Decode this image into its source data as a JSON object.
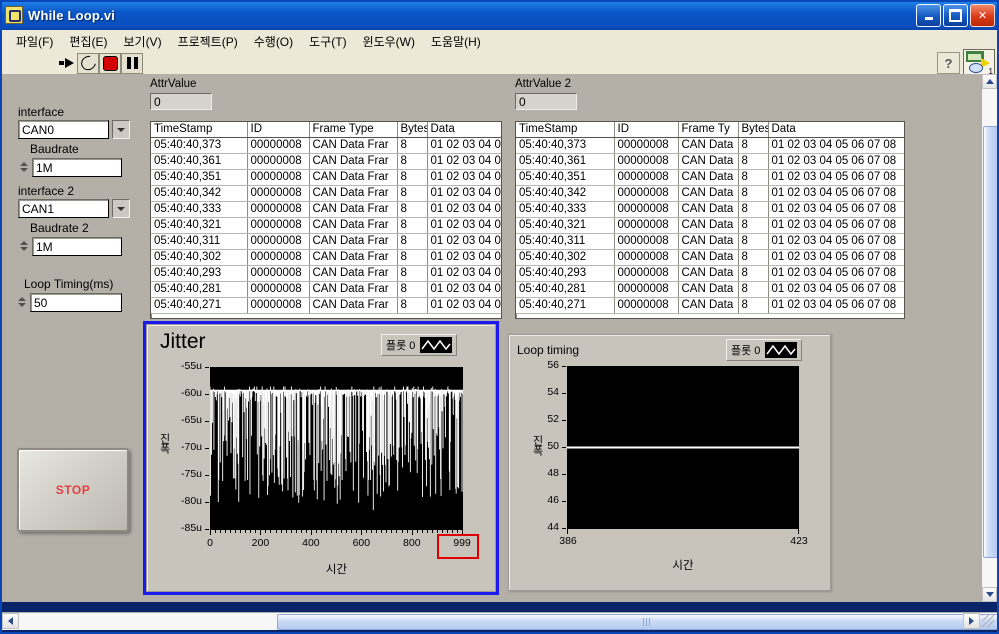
{
  "window": {
    "title": "While Loop.vi",
    "icon": "labview-vi-icon",
    "buttons": {
      "minimize": "–",
      "maximize": "□",
      "close": "✕"
    }
  },
  "menu": [
    {
      "label": "파일(F)",
      "name": "file"
    },
    {
      "label": "편집(E)",
      "name": "edit"
    },
    {
      "label": "보기(V)",
      "name": "view"
    },
    {
      "label": "프로젝트(P)",
      "name": "project"
    },
    {
      "label": "수행(O)",
      "name": "operate"
    },
    {
      "label": "도구(T)",
      "name": "tools"
    },
    {
      "label": "윈도우(W)",
      "name": "window"
    },
    {
      "label": "도움말(H)",
      "name": "help"
    }
  ],
  "toolbar": {
    "run": "run-arrow-icon",
    "run_continuously": "run-continuously-icon",
    "abort": "abort-execution-icon",
    "pause": "pause-icon",
    "help": "?",
    "vi_icon_number": "1"
  },
  "controls": {
    "interface_label": "interface",
    "interface_value": "CAN0",
    "baudrate_label": "Baudrate",
    "baudrate_value": "1M",
    "interface2_label": "interface 2",
    "interface2_value": "CAN1",
    "baudrate2_label": "Baudrate 2",
    "baudrate2_value": "1M",
    "loop_timing_label": "Loop Timing(ms)",
    "loop_timing_value": "50",
    "stop_label": "STOP"
  },
  "table1": {
    "attr_label": "AttrValue",
    "attr_value": "0",
    "columns": [
      "TimeStamp",
      "ID",
      "Frame Type",
      "Bytes",
      "Data"
    ],
    "rows": [
      [
        "05:40:40,373",
        "00000008",
        "CAN Data Frar",
        "8",
        "01 02 03 04 0"
      ],
      [
        "05:40:40,361",
        "00000008",
        "CAN Data Frar",
        "8",
        "01 02 03 04 0"
      ],
      [
        "05:40:40,351",
        "00000008",
        "CAN Data Frar",
        "8",
        "01 02 03 04 0"
      ],
      [
        "05:40:40,342",
        "00000008",
        "CAN Data Frar",
        "8",
        "01 02 03 04 0"
      ],
      [
        "05:40:40,333",
        "00000008",
        "CAN Data Frar",
        "8",
        "01 02 03 04 0"
      ],
      [
        "05:40:40,321",
        "00000008",
        "CAN Data Frar",
        "8",
        "01 02 03 04 0"
      ],
      [
        "05:40:40,311",
        "00000008",
        "CAN Data Frar",
        "8",
        "01 02 03 04 0"
      ],
      [
        "05:40:40,302",
        "00000008",
        "CAN Data Frar",
        "8",
        "01 02 03 04 0"
      ],
      [
        "05:40:40,293",
        "00000008",
        "CAN Data Frar",
        "8",
        "01 02 03 04 0"
      ],
      [
        "05:40:40,281",
        "00000008",
        "CAN Data Frar",
        "8",
        "01 02 03 04 0"
      ],
      [
        "05:40:40,271",
        "00000008",
        "CAN Data Frar",
        "8",
        "01 02 03 04 0"
      ]
    ]
  },
  "table2": {
    "attr_label": "AttrValue 2",
    "attr_value": "0",
    "columns": [
      "TimeStamp",
      "ID",
      "Frame Ty",
      "Bytes",
      "Data"
    ],
    "rows": [
      [
        "05:40:40,373",
        "00000008",
        "CAN Data",
        "8",
        "01 02 03 04 05 06 07 08"
      ],
      [
        "05:40:40,361",
        "00000008",
        "CAN Data",
        "8",
        "01 02 03 04 05 06 07 08"
      ],
      [
        "05:40:40,351",
        "00000008",
        "CAN Data",
        "8",
        "01 02 03 04 05 06 07 08"
      ],
      [
        "05:40:40,342",
        "00000008",
        "CAN Data",
        "8",
        "01 02 03 04 05 06 07 08"
      ],
      [
        "05:40:40,333",
        "00000008",
        "CAN Data",
        "8",
        "01 02 03 04 05 06 07 08"
      ],
      [
        "05:40:40,321",
        "00000008",
        "CAN Data",
        "8",
        "01 02 03 04 05 06 07 08"
      ],
      [
        "05:40:40,311",
        "00000008",
        "CAN Data",
        "8",
        "01 02 03 04 05 06 07 08"
      ],
      [
        "05:40:40,302",
        "00000008",
        "CAN Data",
        "8",
        "01 02 03 04 05 06 07 08"
      ],
      [
        "05:40:40,293",
        "00000008",
        "CAN Data",
        "8",
        "01 02 03 04 05 06 07 08"
      ],
      [
        "05:40:40,281",
        "00000008",
        "CAN Data",
        "8",
        "01 02 03 04 05 06 07 08"
      ],
      [
        "05:40:40,271",
        "00000008",
        "CAN Data",
        "8",
        "01 02 03 04 05 06 07 08"
      ]
    ]
  },
  "chart_data": [
    {
      "type": "line",
      "name": "jitter-chart",
      "title": "Jitter",
      "xlabel": "시간",
      "ylabel": "진폭",
      "legend": {
        "label": "플롯 0",
        "position": "top-right",
        "color": "#ffffff"
      },
      "selected": true,
      "ylim": [
        -85,
        -55
      ],
      "yticks": [
        -55,
        -60,
        -65,
        -70,
        -75,
        -80,
        -85
      ],
      "ytick_labels": [
        "-55u",
        "-60u",
        "-65u",
        "-70u",
        "-75u",
        "-80u",
        "-85u"
      ],
      "xlim": [
        0,
        999
      ],
      "xticks": [
        0,
        200,
        400,
        600,
        800,
        999
      ],
      "xtick_labels": [
        "0",
        "200",
        "400",
        "600",
        "800",
        "999"
      ],
      "highlighted_tick": "999",
      "highlight_color": "#e00000",
      "plot_background": "#000000",
      "trace_color": "#ffffff",
      "grid": false,
      "description": "dense noisy jitter trace, baseline near -59u with downward spikes to about -80u",
      "series": [
        {
          "name": "플롯 0",
          "values": [
            -59.2,
            -62.5,
            -59.4,
            -71.0,
            -60.1,
            -66.3,
            -59.3,
            -74.8,
            -61.0,
            -59.5,
            -68.2,
            -59.3,
            -76.5,
            -62.0,
            -59.4,
            -70.1,
            -59.2,
            -65.4,
            -78.0,
            -60.3,
            -59.4,
            -73.2,
            -61.5,
            -59.3,
            -67.0,
            -59.5,
            -75.9,
            -62.8,
            -59.3,
            -69.4,
            -59.4,
            -63.1,
            -79.5,
            -60.0,
            -59.3,
            -72.0,
            -61.2,
            -59.4,
            -66.8,
            -59.2,
            -77.1,
            -63.5,
            -59.4,
            -70.6,
            -59.3,
            -64.2,
            -75.0,
            -60.8,
            -59.4,
            -68.9,
            -59.2,
            -74.1,
            -62.2,
            -59.5,
            -66.0,
            -59.3,
            -71.7,
            -60.4,
            -59.4,
            -78.3,
            -63.0,
            -59.3,
            -67.6,
            -59.4,
            -73.5,
            -61.1,
            -59.2,
            -69.0,
            -59.5,
            -76.2,
            -62.6,
            -59.3,
            -65.1,
            -59.4,
            -70.9,
            -60.6,
            -59.3,
            -74.4,
            -63.8,
            -59.4,
            -68.1,
            -59.2,
            -77.8,
            -61.7,
            -59.5,
            -66.5,
            -59.3,
            -72.3,
            -60.2,
            -59.4,
            -69.7,
            -59.3,
            -75.4,
            -62.1,
            -59.4,
            -64.8,
            -59.2,
            -71.2,
            -60.9,
            -59.4,
            -78.9
          ]
        }
      ]
    },
    {
      "type": "line",
      "name": "loop-timing-chart",
      "title": "Loop timing",
      "xlabel": "시간",
      "ylabel": "진폭",
      "legend": {
        "label": "플롯 0",
        "position": "top-right",
        "color": "#ffffff"
      },
      "selected": false,
      "ylim": [
        44,
        56
      ],
      "yticks": [
        56,
        54,
        52,
        50,
        48,
        46,
        44
      ],
      "ytick_labels": [
        "56",
        "54",
        "52",
        "50",
        "48",
        "46",
        "44"
      ],
      "xlim": [
        386,
        423
      ],
      "xticks": [
        386,
        423
      ],
      "xtick_labels": [
        "386",
        "423"
      ],
      "plot_background": "#000000",
      "trace_color": "#ffffff",
      "grid": false,
      "description": "constant flat trace at 50 ms across the whole window",
      "series": [
        {
          "name": "플롯 0",
          "constant_value": 50
        }
      ]
    }
  ],
  "scrollbars": {
    "vertical_up": "▲",
    "vertical_down": "▼",
    "horizontal_left": "◀",
    "horizontal_right": "▶"
  }
}
